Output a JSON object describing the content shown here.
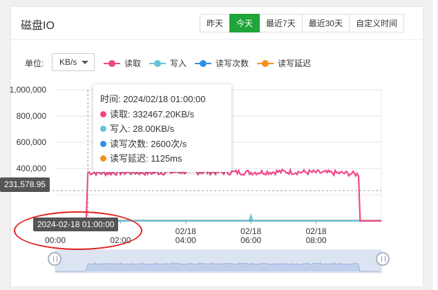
{
  "panel": {
    "title": "磁盘IO"
  },
  "range_buttons": [
    {
      "label": "昨天",
      "active": false
    },
    {
      "label": "今天",
      "active": true
    },
    {
      "label": "最近7天",
      "active": false
    },
    {
      "label": "最近30天",
      "active": false
    },
    {
      "label": "自定义时间",
      "active": false
    }
  ],
  "controls": {
    "unit_label": "单位:",
    "unit_value": "KB/s"
  },
  "legend": [
    {
      "name": "读取",
      "color": "#f0468a"
    },
    {
      "name": "写入",
      "color": "#66c2d8"
    },
    {
      "name": "读写次数",
      "color": "#2f8fe6"
    },
    {
      "name": "读写延迟",
      "color": "#f4901e"
    }
  ],
  "tooltip": {
    "time": "时间: 2024/02/18 01:00:00",
    "rows": [
      {
        "text": "读取: 332467.20KB/s",
        "color": "#f0468a"
      },
      {
        "text": "写入: 28.00KB/s",
        "color": "#66c2d8"
      },
      {
        "text": "读写次数: 2600次/s",
        "color": "#2f8fe6"
      },
      {
        "text": "读写延迟: 1125ms",
        "color": "#f4901e"
      }
    ]
  },
  "pointer": {
    "y_value": "231,578.95",
    "x_value": "2024-02-18 01:00:00"
  },
  "chart_data": {
    "type": "line",
    "y_ticks": [
      "1,000,000",
      "800,000",
      "600,000",
      "400,000",
      "0"
    ],
    "x_ticks": [
      {
        "date": "",
        "time": "00:00"
      },
      {
        "date": "",
        "time": "02:00"
      },
      {
        "date": "02/18",
        "time": "04:00"
      },
      {
        "date": "02/18",
        "time": "06:00"
      },
      {
        "date": "02/18",
        "time": "08:00"
      }
    ],
    "ylim": [
      0,
      1000000
    ],
    "xlim_hours": [
      0,
      10
    ],
    "series": [
      {
        "name": "读取",
        "color": "#f0468a",
        "x": [
          0,
          0.95,
          1.0,
          1.5,
          2,
          3,
          4,
          5,
          6,
          7,
          8,
          9,
          9.3,
          9.35,
          9.5,
          10
        ],
        "y": [
          0,
          0,
          370000,
          365000,
          370000,
          368000,
          375000,
          372000,
          370000,
          375000,
          370000,
          362000,
          355000,
          0,
          0,
          0
        ]
      },
      {
        "name": "写入",
        "color": "#66c2d8",
        "x": [
          0,
          5.95,
          6.0,
          6.05,
          10
        ],
        "y": [
          2000,
          2000,
          40000,
          2000,
          2000
        ]
      },
      {
        "name": "读写次数",
        "color": "#2f8fe6",
        "x": [
          0,
          10
        ],
        "y": [
          1000,
          1000
        ]
      },
      {
        "name": "读写延迟",
        "color": "#f4901e",
        "x": [
          0,
          10
        ],
        "y": [
          3000,
          3000
        ]
      }
    ]
  }
}
